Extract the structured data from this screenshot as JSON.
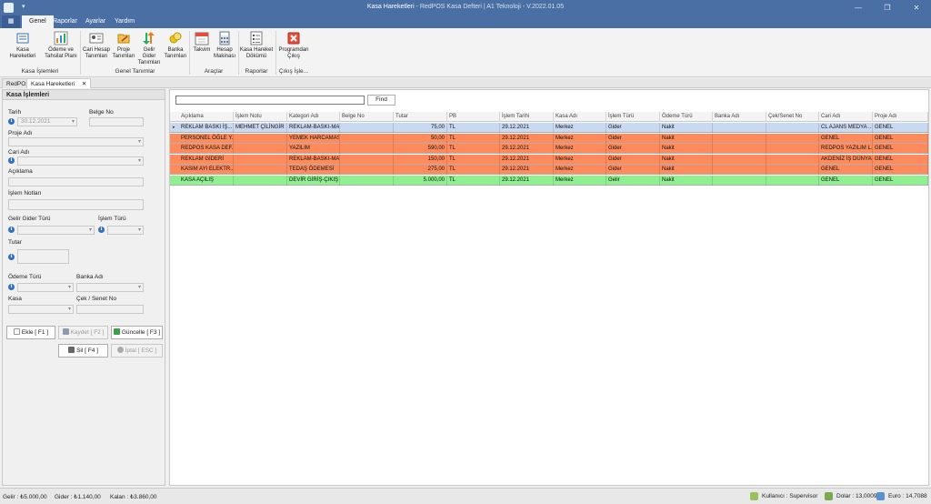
{
  "window": {
    "title": "Kasa Hareketleri",
    "subtitle": " - RedPOS Kasa Defteri  |  A1 Teknoloji - V.2022.01.05",
    "qat_glyph": "▾",
    "minimize": "—",
    "restore": "❐",
    "close": "✕"
  },
  "ribbon_tabs": [
    "Genel",
    "Raporlar",
    "Ayarlar",
    "Yardım"
  ],
  "ribbon": {
    "kasa_hareketleri": "Kasa Hareketleri",
    "odeme_line1": "Ödeme ve",
    "odeme_line2": "Tahsilat Planı",
    "cari_line1": "Cari Hesap",
    "cari_line2": "Tanımları",
    "proje_line1": "Proje",
    "proje_line2": "Tanımları",
    "gelir_line1": "Gelir Gider",
    "gelir_line2": "Tanımları",
    "banka_line1": "Banka",
    "banka_line2": "Tanımları",
    "takvim": "Takvim",
    "hesap_line1": "Hesap",
    "hesap_line2": "Makinası",
    "dokum_line1": "Kasa Hareket",
    "dokum_line2": "Dökümü",
    "cikis_line1": "Programdan",
    "cikis_line2": "Çıkış",
    "groups": [
      "Kasa İşlemleri",
      "Genel Tanımlar",
      "Araçlar",
      "Raporlar",
      "Çıkış İşle..."
    ]
  },
  "doc_tabs": [
    "RedPOS",
    "Kasa Hareketleri"
  ],
  "doc_tab_close": "✕",
  "form": {
    "header": "Kasa İşlemleri",
    "tarih_label": "Tarih",
    "tarih_value": "30.12.2021",
    "belge_no_label": "Belge No",
    "proje_adi_label": "Proje Adı",
    "cari_adi_label": "Cari Adı",
    "aciklama_label": "Açıklama",
    "islem_notlari_label": "İşlem Notları",
    "gelir_gider_turu_label": "Gelir Gider Türü",
    "islem_turu_label": "İşlem Türü",
    "tutar_label": "Tutar",
    "odeme_turu_label": "Ödeme Türü",
    "banka_adi_label": "Banka Adı",
    "kasa_label": "Kasa",
    "cek_senet_no_label": "Çek / Senet No",
    "info_glyph": "i"
  },
  "actions": {
    "ekle": "Ekle [ F1 ]",
    "kaydet": "Kaydet [ F2 ]",
    "guncelle": "Güncelle [ F3 ]",
    "sil": "Sil [ F4 ]",
    "iptal": "İptal [ ESC ]"
  },
  "grid": {
    "find_label": "Find",
    "row_indicator": "▸",
    "columns": [
      "Açıklama",
      "İşlem Notu",
      "Kategori Adı",
      "Belge No",
      "Tutar",
      "PB",
      "İşlem Tarihi",
      "Kasa Adı",
      "İşlem Türü",
      "Ödeme Türü",
      "Banka Adı",
      "Çek/Senet No",
      "Cari Adı",
      "Proje Adı"
    ],
    "rows": [
      {
        "c": [
          "REKLAM BASKI İŞ...",
          "MEHMET ÇİLİNGİR ...",
          "REKLAM-BASKI-MA...",
          "",
          "75,00",
          "TL",
          "29.12.2021",
          "Merkez",
          "Gider",
          "Nakit",
          "",
          "",
          "CL AJANS MEDYA ...",
          "GENEL"
        ],
        "color": "#c9d9f2"
      },
      {
        "c": [
          "PERSONEL ÖĞLE Y...",
          "",
          "YEMEK HARCAMASI",
          "",
          "50,00",
          "TL",
          "29.12.2021",
          "Merkez",
          "Gider",
          "Nakit",
          "",
          "",
          "GENEL",
          "GENEL"
        ],
        "color": "#ff8a5b"
      },
      {
        "c": [
          "REDPOS KASA DEF...",
          "",
          "YAZILIM",
          "",
          "590,00",
          "TL",
          "29.12.2021",
          "Merkez",
          "Gider",
          "Nakit",
          "",
          "",
          "REDPOS YAZILIM L...",
          "GENEL"
        ],
        "color": "#ff8a5b"
      },
      {
        "c": [
          "REKLAM GİDERİ",
          "",
          "REKLAM-BASKI-MA...",
          "",
          "150,00",
          "TL",
          "29.12.2021",
          "Merkez",
          "Gider",
          "Nakit",
          "",
          "",
          "AKDENİZ İŞ DÜNYA...",
          "GENEL"
        ],
        "color": "#ff8a5b"
      },
      {
        "c": [
          "KASIM AYI ELEKTR...",
          "",
          "TEDAŞ ÖDEMESİ",
          "",
          "275,00",
          "TL",
          "29.12.2021",
          "Merkez",
          "Gider",
          "Nakit",
          "",
          "",
          "GENEL",
          "GENEL"
        ],
        "color": "#ff8a5b"
      },
      {
        "c": [
          "KASA AÇILIŞ",
          "",
          "DEVİR GİRİŞ-ÇIKIŞ",
          "",
          "5.000,00",
          "TL",
          "29.12.2021",
          "Merkez",
          "Gelir",
          "Nakit",
          "",
          "",
          "GENEL",
          "GENEL"
        ],
        "color": "#8ff08f"
      }
    ]
  },
  "status": {
    "gelir": "Gelir :  ₺5.000,00",
    "gider": "Gider :  ₺1.140,00",
    "kalan": "Kalan :  ₺3.860,00",
    "kullanici": "Kullanıcı :   Supervisor",
    "dolar": "Dolar :   13,0009",
    "euro": "Euro :   14,7088"
  }
}
